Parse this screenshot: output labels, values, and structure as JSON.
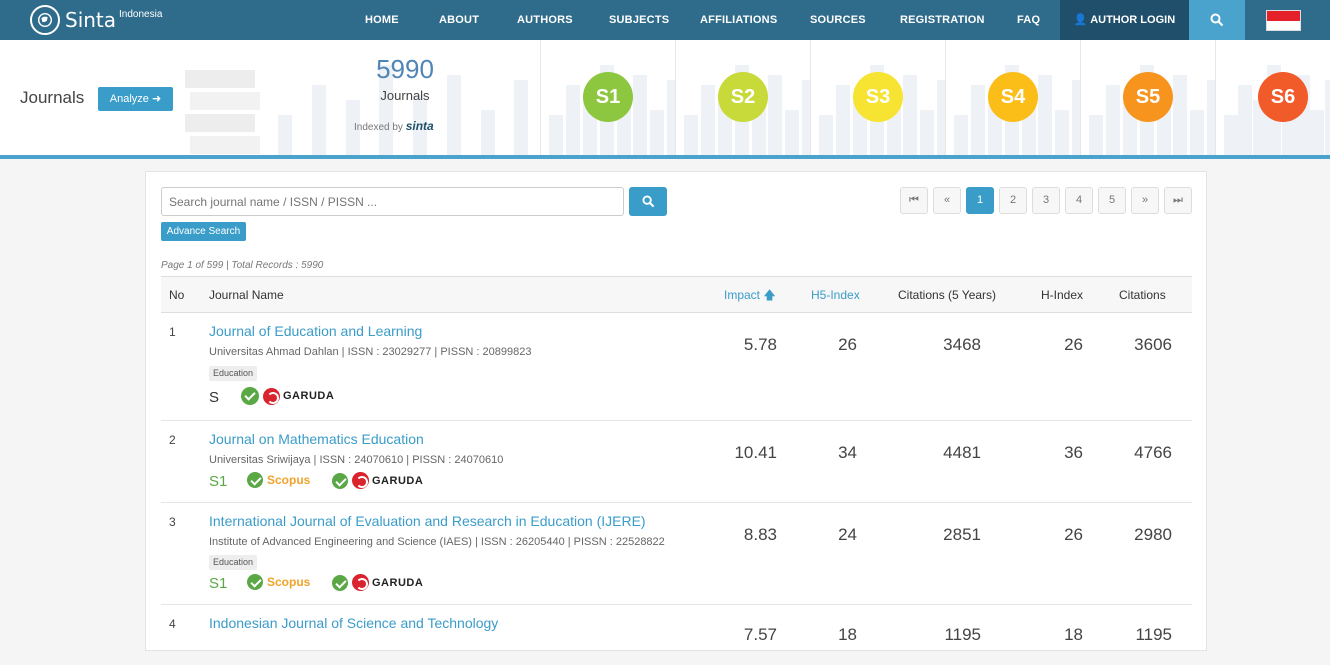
{
  "brand": {
    "name": "Sinta",
    "sup": "Indonesia"
  },
  "nav": {
    "items": [
      "HOME",
      "ABOUT",
      "AUTHORS",
      "SUBJECTS",
      "AFFILIATIONS",
      "SOURCES",
      "REGISTRATION",
      "FAQ"
    ],
    "login_label": "AUTHOR LOGIN"
  },
  "header": {
    "title": "Journals",
    "analyze_label": "Analyze",
    "count": "5990",
    "count_label": "Journals",
    "indexed_label": "Indexed by",
    "indexed_brand": "sinta",
    "accreditation": [
      {
        "label": "S1",
        "color": "#8dc63f"
      },
      {
        "label": "S2",
        "color": "#c8d93a"
      },
      {
        "label": "S3",
        "color": "#f6e332"
      },
      {
        "label": "S4",
        "color": "#fbbd18"
      },
      {
        "label": "S5",
        "color": "#f7941d"
      },
      {
        "label": "S6",
        "color": "#f15a29"
      }
    ]
  },
  "search": {
    "placeholder": "Search journal name / ISSN / PISSN ...",
    "advance_label": "Advance Search"
  },
  "pagination": [
    "1",
    "2",
    "3",
    "4",
    "5"
  ],
  "meta": "Page 1 of 599 | Total Records : 5990",
  "table": {
    "headers": {
      "no": "No",
      "name": "Journal Name",
      "impact": "Impact",
      "h5": "H5-Index",
      "cit5": "Citations (5 Years)",
      "h": "H-Index",
      "cit": "Citations"
    },
    "rows": [
      {
        "no": "1",
        "name": "Journal of Education and Learning",
        "aff": "Universitas Ahmad Dahlan | ISSN : 23029277 | PISSN : 20899823",
        "subject": "Education",
        "accreditation": "S",
        "impact": "5.78",
        "h5": "26",
        "cit5": "3468",
        "h": "26",
        "cit": "3606"
      },
      {
        "no": "2",
        "name": "Journal on Mathematics Education",
        "aff": "Universitas Sriwijaya | ISSN : 24070610 | PISSN : 24070610",
        "subject": "",
        "accreditation": "S1",
        "impact": "10.41",
        "h5": "34",
        "cit5": "4481",
        "h": "36",
        "cit": "4766"
      },
      {
        "no": "3",
        "name": "International Journal of Evaluation and Research in Education (IJERE)",
        "aff": "Institute of Advanced Engineering and Science (IAES) | ISSN : 26205440 | PISSN : 22528822",
        "subject": "Education",
        "accreditation": "S1",
        "impact": "8.83",
        "h5": "24",
        "cit5": "2851",
        "h": "26",
        "cit": "2980"
      },
      {
        "no": "4",
        "name": "Indonesian Journal of Science and Technology",
        "aff": "",
        "subject": "",
        "accreditation": "",
        "impact": "7.57",
        "h5": "18",
        "cit5": "1195",
        "h": "18",
        "cit": "1195"
      }
    ]
  },
  "index_labels": {
    "scopus": "Scopus",
    "garuda": "GARUDA"
  }
}
